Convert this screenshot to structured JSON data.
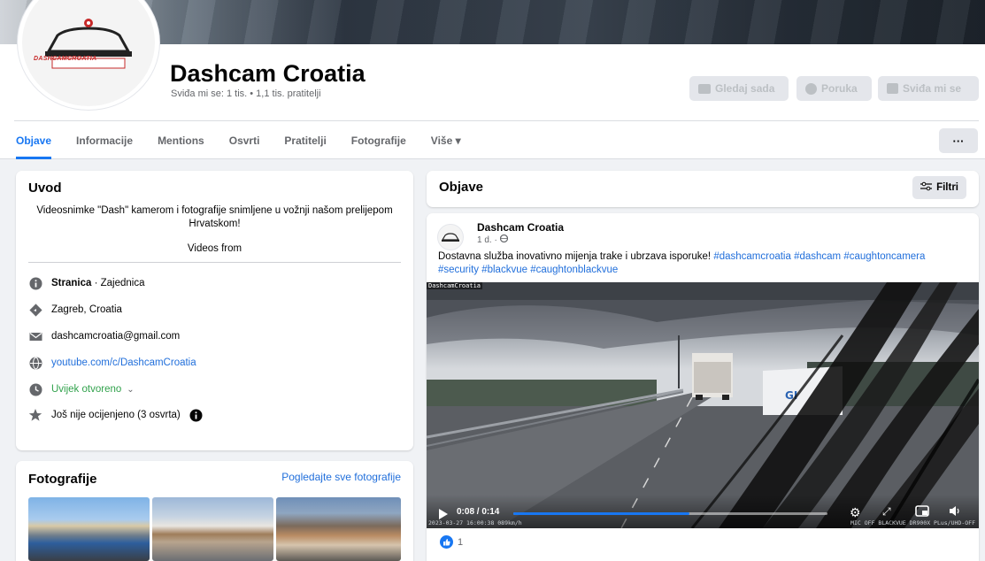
{
  "page": {
    "name": "Dashcam Croatia",
    "logo_text": "DASHCAMCROATIA",
    "stats": "Sviđa mi se: 1 tis. • 1,1 tis. pratitelji"
  },
  "header_buttons": {
    "watch": "Gledaj sada",
    "message": "Poruka",
    "like": "Sviđa mi se"
  },
  "tabs": [
    "Objave",
    "Informacije",
    "Mentions",
    "Osvrti",
    "Pratitelji",
    "Fotografije",
    "Više ▾"
  ],
  "more_button": "···",
  "intro": {
    "title": "Uvod",
    "description": "Videosnimke \"Dash\" kamerom i fotografije snimljene u vožnji našom prelijepom Hrvatskom!",
    "videos_from": "Videos from",
    "category_bold": "Stranica",
    "category_rest": " · Zajednica",
    "location": "Zagreb, Croatia",
    "email": "dashcamcroatia@gmail.com",
    "youtube": "youtube.com/c/DashcamCroatia",
    "hours": "Uvijek otvoreno",
    "rating": "Još nije ocijenjeno (3 osvrta)"
  },
  "photos": {
    "title": "Fotografije",
    "see_all": "Pogledajte sve fotografije"
  },
  "posts_header": {
    "title": "Objave",
    "filter": "Filtri"
  },
  "post": {
    "author": "Dashcam Croatia",
    "meta": "1 d. · ",
    "text_plain": "Dostavna služba inovativno mijenja trake i ubrzava isporuke! ",
    "text_tags": "#dashcamcroatia #dashcam #caughtoncamera #security #blackvue #caughtonblackvue",
    "video_tag": "DashcamCroatia",
    "video_time": "0:08 / 0:14",
    "progress": 0.56,
    "osd_left": "2023-03-27 16:00:38 089km/h",
    "osd_right": "MIC OFF BLACKVUE DR900X PLus/UHD-OFF",
    "reactions_count": "1"
  },
  "colors": {
    "accent": "#1877f2",
    "link": "#216fdb",
    "open_status": "#31a24c"
  }
}
